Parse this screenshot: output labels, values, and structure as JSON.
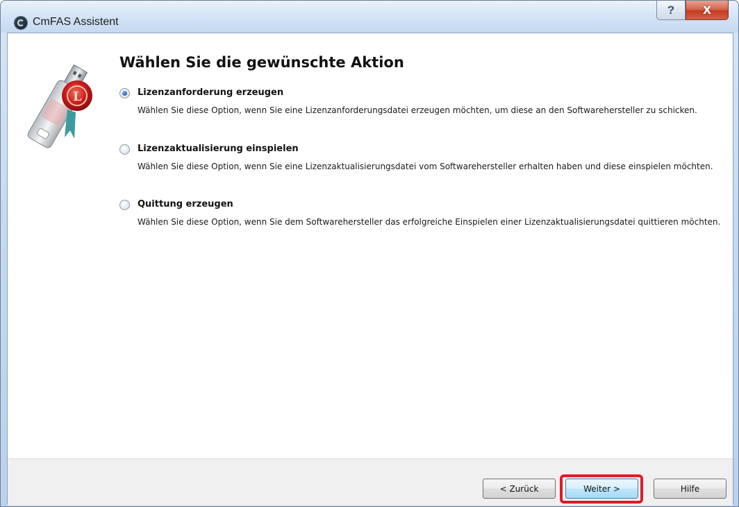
{
  "window": {
    "title": "CmFAS Assistent",
    "help_label": "?",
    "close_label": "X"
  },
  "page": {
    "heading": "Wählen Sie die gewünschte Aktion",
    "options": [
      {
        "label": "Lizenzanforderung erzeugen",
        "description": "Wählen Sie diese Option, wenn Sie eine Lizenzanforderungsdatei erzeugen möchten, um diese an den Softwarehersteller zu schicken.",
        "selected": true
      },
      {
        "label": "Lizenzaktualisierung einspielen",
        "description": "Wählen Sie diese Option, wenn Sie eine Lizenzaktualisierungsdatei vom Softwarehersteller erhalten haben und diese einspielen möchten.",
        "selected": false
      },
      {
        "label": "Quittung erzeugen",
        "description": "Wählen Sie diese Option, wenn Sie dem Softwarehersteller das erfolgreiche Einspielen einer Lizenzaktualisierungsdatei quittieren möchten.",
        "selected": false
      }
    ]
  },
  "footer": {
    "back_label": "< Zurück",
    "next_label": "Weiter >",
    "help_label": "Hilfe"
  },
  "colors": {
    "highlight": "#e01b24",
    "default_button_border": "#3c7fb1"
  }
}
